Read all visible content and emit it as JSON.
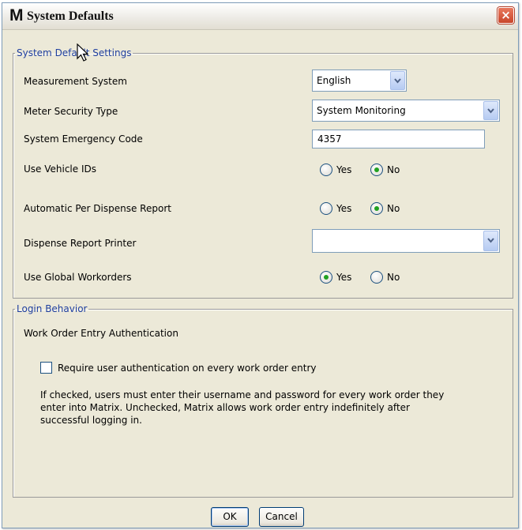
{
  "window": {
    "app_logo": "M",
    "title": "System Defaults",
    "close_label": "×"
  },
  "system_defaults": {
    "legend": "System Default Settings",
    "measurement_system": {
      "label": "Measurement System",
      "value": "English"
    },
    "meter_security_type": {
      "label": "Meter Security Type",
      "value": "System Monitoring"
    },
    "system_emergency_code": {
      "label": "System Emergency Code",
      "value": "4357"
    },
    "use_vehicle_ids": {
      "label": "Use Vehicle IDs",
      "yes": "Yes",
      "no": "No",
      "selected": "No"
    },
    "automatic_per_dispense_report": {
      "label": "Automatic Per Dispense Report",
      "yes": "Yes",
      "no": "No",
      "selected": "No"
    },
    "dispense_report_printer": {
      "label": "Dispense Report Printer",
      "value": ""
    },
    "use_global_workorders": {
      "label": "Use Global Workorders",
      "yes": "Yes",
      "no": "No",
      "selected": "Yes"
    }
  },
  "login_behavior": {
    "legend": "Login Behavior",
    "heading": "Work Order Entry Authentication",
    "checkbox_label": "Require user authentication on every work order entry",
    "checkbox_checked": false,
    "description_line1": "If checked, users must enter their username and password for every work order they",
    "description_line2": "enter into Matrix.  Unchecked, Matrix allows work order entry indefinitely after",
    "description_line3": "successful logging in."
  },
  "buttons": {
    "ok": "OK",
    "cancel": "Cancel"
  },
  "colors": {
    "legend_text": "#1f3f9f",
    "dialog_bg": "#ece9d8",
    "radio_checked": "#21a121",
    "close_button": "#c8452a"
  }
}
